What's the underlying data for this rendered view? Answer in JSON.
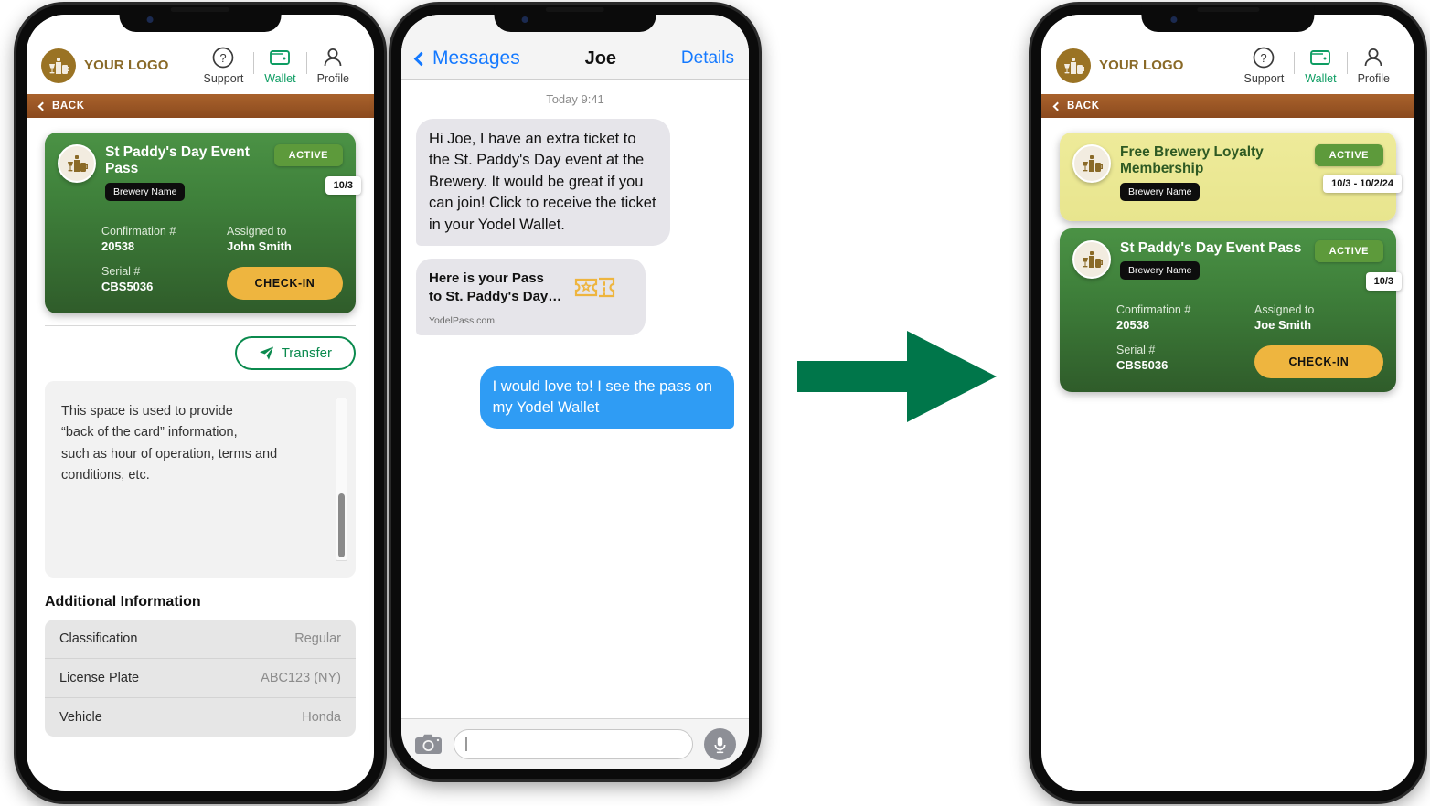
{
  "brand": {
    "name": "YOUR LOGO",
    "logo_icon": "brewery-drinks-icon",
    "color": "#8a6a28"
  },
  "nav": {
    "items": [
      {
        "label": "Support",
        "icon": "question-circle-icon",
        "active": false
      },
      {
        "label": "Wallet",
        "icon": "wallet-icon",
        "active": true
      },
      {
        "label": "Profile",
        "icon": "person-icon",
        "active": false
      }
    ]
  },
  "back_bar": {
    "label": "BACK",
    "icon": "chevron-left-icon"
  },
  "phone1": {
    "pass": {
      "title": "St Paddy's Day Event Pass",
      "brewery_chip": "Brewery Name",
      "status": "ACTIVE",
      "date_chip": "10/3",
      "fields": [
        {
          "label": "Confirmation #",
          "value": "20538"
        },
        {
          "label": "Assigned to",
          "value": "John Smith"
        },
        {
          "label": "Serial #",
          "value": "CBS5036"
        }
      ],
      "action_button": "CHECK-IN"
    },
    "transfer_button": "Transfer",
    "back_of_card_text": "This space is used to provide\n“back of the card” information,\nsuch as hour of operation, terms and\nconditions, etc.",
    "additional_information": {
      "title": "Additional Information",
      "rows": [
        {
          "key": "Classification",
          "value": "Regular"
        },
        {
          "key": "License Plate",
          "value": "ABC123 (NY)"
        },
        {
          "key": "Vehicle",
          "value": "Honda"
        }
      ]
    }
  },
  "phone2": {
    "header": {
      "back_label": "Messages",
      "contact_name": "Joe",
      "details_label": "Details"
    },
    "timestamp": "Today 9:41",
    "messages": [
      {
        "direction": "in",
        "text": "Hi Joe, I have an extra ticket to the St. Paddy's Day event at the Brewery. It would be great if you can join! Click to receive the ticket in your Yodel Wallet."
      },
      {
        "direction": "in",
        "type": "link-preview",
        "title": "Here is your Pass\nto St. Paddy's Day…",
        "url": "YodelPass.com",
        "icon": "ticket-icon"
      },
      {
        "direction": "out",
        "text": "I would love to! I see the pass on my Yodel Wallet"
      }
    ],
    "input_bar": {
      "camera_icon": "camera-icon",
      "field_value": "",
      "mic_icon": "microphone-icon"
    }
  },
  "phone3": {
    "cards": [
      {
        "theme": "yellow",
        "title": "Free Brewery Loyalty Membership",
        "brewery_chip": "Brewery Name",
        "status": "ACTIVE",
        "date_chip": "10/3 - 10/2/24"
      },
      {
        "theme": "green",
        "title": "St Paddy's Day Event Pass",
        "brewery_chip": "Brewery Name",
        "status": "ACTIVE",
        "date_chip": "10/3",
        "fields": [
          {
            "label": "Confirmation #",
            "value": "20538"
          },
          {
            "label": "Assigned to",
            "value": "Joe Smith"
          },
          {
            "label": "Serial #",
            "value": "CBS5036"
          }
        ],
        "action_button": "CHECK-IN"
      }
    ]
  },
  "arrow": {
    "name": "flow-arrow-right",
    "color": "#00764a"
  },
  "colors": {
    "brand_brown": "#8a6a28",
    "back_bar": "#a9622c",
    "card_green": "#3e7f3a",
    "card_yellow": "#e8e58e",
    "active_badge": "#5d9a3b",
    "checkin_yellow": "#eeb53f",
    "wallet_green": "#0e9d63",
    "imessage_blue": "#2f9cf4",
    "arrow_green": "#00764a"
  }
}
